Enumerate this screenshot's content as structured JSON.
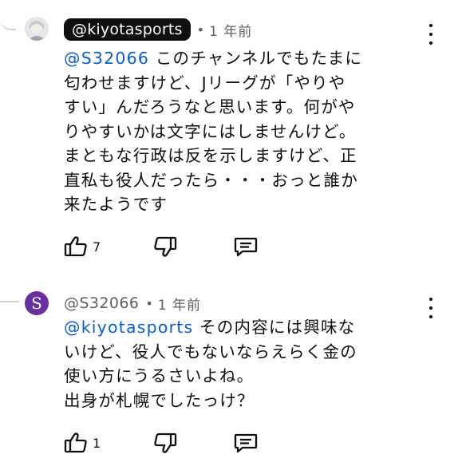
{
  "comments": [
    {
      "author": "@kiyotasports",
      "separator": "•",
      "time": "1 年前",
      "mention": "@S32066",
      "text": " このチャンネルでもたまに\n匂わせますけど、Jリーグが「やりや\nすい」んだろうなと思います。何がや\nりやすいかは文字にはしませんけど。\nまともな行政は反を示しますけど、正\n直私も役人だったら・・・おっと誰か\n来たようです",
      "likes": "7",
      "avatar_icon": "user-photo-icon"
    },
    {
      "author": "@S32066",
      "avatar_letter": "S",
      "separator": "•",
      "time": "1 年前",
      "mention": "@kiyotasports",
      "text": " その内容には興味な\nいけど、役人でもないならえらく金の\n使い方にうるさいよね。\n出身が札幌でしたっけ？",
      "likes": "1"
    }
  ],
  "icons": {
    "like": "thumbs-up-icon",
    "dislike": "thumbs-down-icon",
    "reply": "reply-comment-icon",
    "menu": "more-vertical-icon"
  },
  "colors": {
    "mention": "#065fd4",
    "meta": "#606060",
    "avatar_s": "#6a2fa0"
  }
}
